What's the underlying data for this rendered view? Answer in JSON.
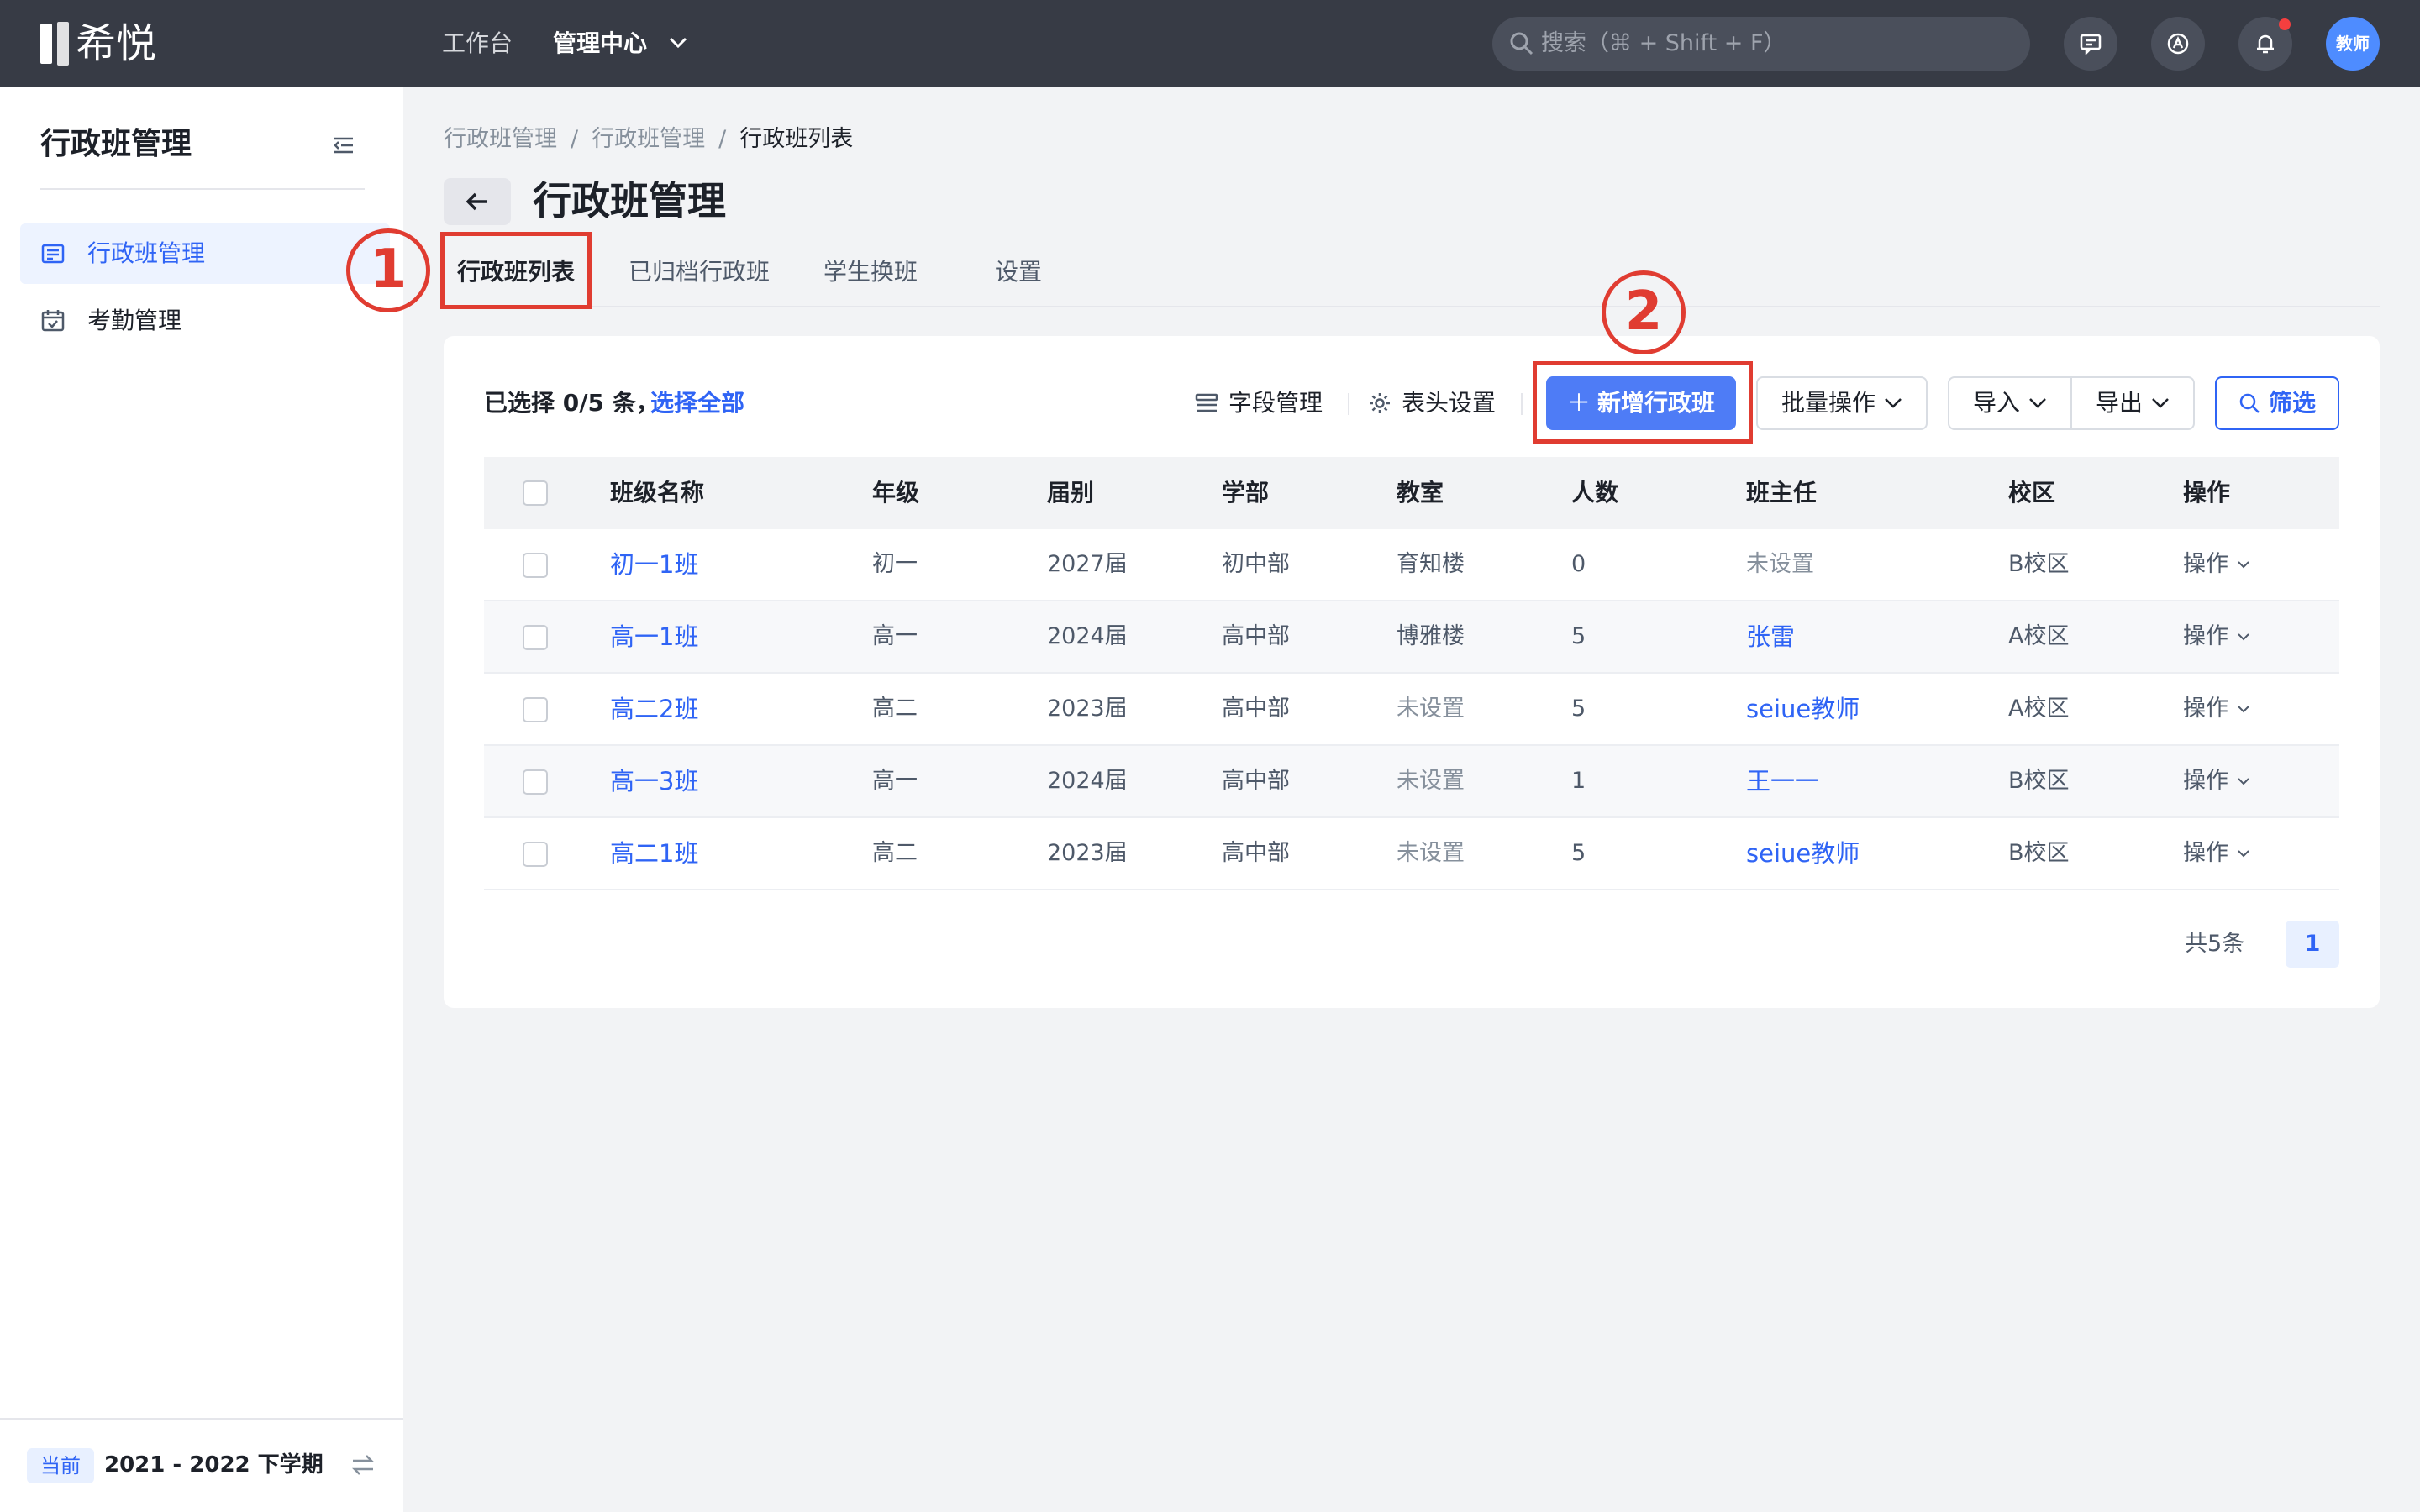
{
  "header": {
    "logo_text": "希悦",
    "nav": {
      "workbench": "工作台",
      "admin_center": "管理中心"
    },
    "search_placeholder": "搜索（⌘ + Shift + F）",
    "avatar_label": "教师",
    "colors": {
      "topbar": "#373b45",
      "accent": "#2f64f5",
      "notification": "#f53f3f"
    }
  },
  "sidebar": {
    "title": "行政班管理",
    "items": [
      {
        "label": "行政班管理",
        "icon": "list-icon",
        "active": true
      },
      {
        "label": "考勤管理",
        "icon": "calendar-check-icon",
        "active": false
      }
    ],
    "footer": {
      "current_label": "当前",
      "term": "2021 - 2022 下学期"
    }
  },
  "breadcrumb": [
    "行政班管理",
    "行政班管理",
    "行政班列表"
  ],
  "page_title": "行政班管理",
  "tabs": [
    "行政班列表",
    "已归档行政班",
    "学生换班",
    "设置"
  ],
  "annotations": {
    "step1": "1",
    "step2": "2"
  },
  "toolbar": {
    "selected_text": "已选择 0/5 条，",
    "select_all": "选择全部",
    "field_management": "字段管理",
    "header_settings": "表头设置",
    "add_class": "新增行政班",
    "batch_ops": "批量操作",
    "import": "导入",
    "export": "导出",
    "filter": "筛选"
  },
  "table": {
    "columns": [
      "班级名称",
      "年级",
      "届别",
      "学部",
      "教室",
      "人数",
      "班主任",
      "校区",
      "操作"
    ],
    "rows": [
      {
        "name": "初一1班",
        "grade": "初一",
        "cohort": "2027届",
        "division": "初中部",
        "room": "育知楼",
        "count": "0",
        "teacher": "未设置",
        "campus": "B校区",
        "action": "操作"
      },
      {
        "name": "高一1班",
        "grade": "高一",
        "cohort": "2024届",
        "division": "高中部",
        "room": "博雅楼",
        "count": "5",
        "teacher": "张雷",
        "campus": "A校区",
        "action": "操作"
      },
      {
        "name": "高二2班",
        "grade": "高二",
        "cohort": "2023届",
        "division": "高中部",
        "room": "未设置",
        "count": "5",
        "teacher": "seiue教师",
        "campus": "A校区",
        "action": "操作"
      },
      {
        "name": "高一3班",
        "grade": "高一",
        "cohort": "2024届",
        "division": "高中部",
        "room": "未设置",
        "count": "1",
        "teacher": "王一一",
        "campus": "B校区",
        "action": "操作"
      },
      {
        "name": "高二1班",
        "grade": "高二",
        "cohort": "2023届",
        "division": "高中部",
        "room": "未设置",
        "count": "5",
        "teacher": "seiue教师",
        "campus": "B校区",
        "action": "操作"
      }
    ]
  },
  "pagination": {
    "total": "共5条",
    "current_page": "1"
  }
}
